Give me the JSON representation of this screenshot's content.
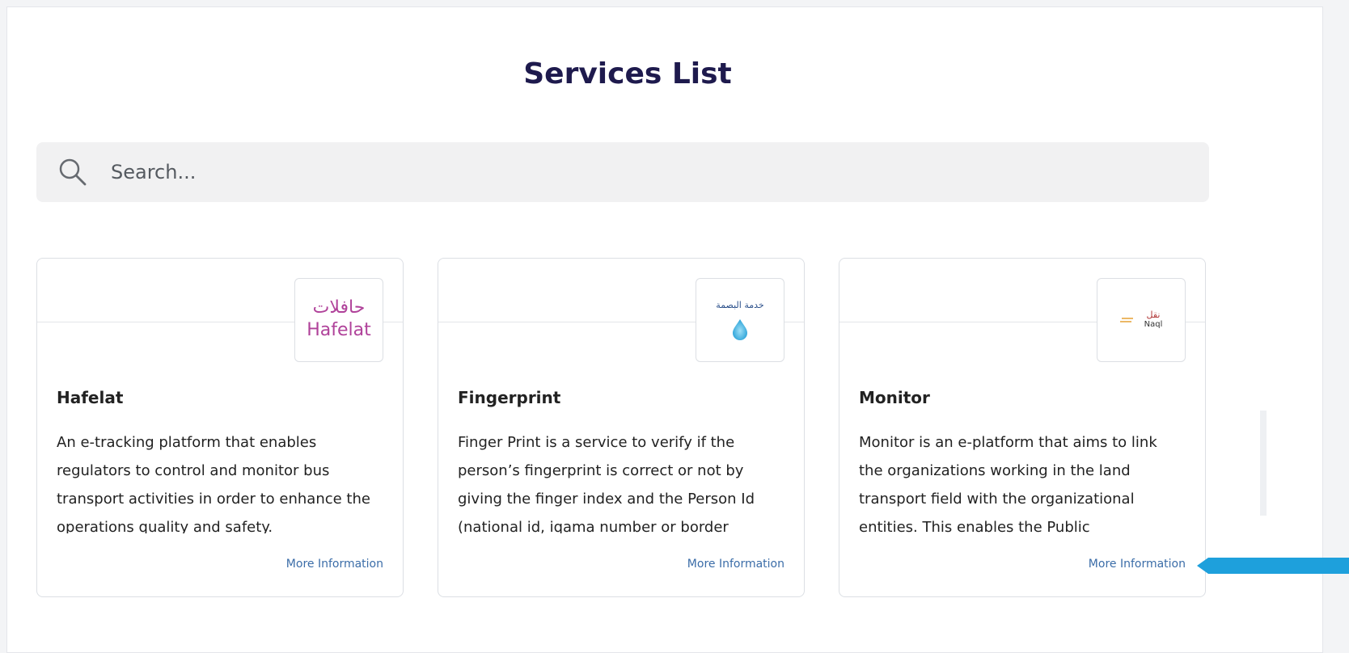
{
  "page": {
    "title": "Services List"
  },
  "search": {
    "placeholder": "Search...",
    "icon": "search-icon"
  },
  "services": [
    {
      "title": "Hafelat",
      "description": "An e-tracking platform that enables regulators to control and monitor bus transport activities in order to enhance the operations quality and safety.",
      "more_label": "More Information",
      "logo": {
        "text_ar": "حافلات",
        "text_en": "Hafelat",
        "color": "#b0429a"
      }
    },
    {
      "title": "Fingerprint",
      "description": "Finger Print is a service to verify if the person’s fingerprint is correct or not by giving the finger index and the Person Id (national id, iqama number or border",
      "more_label": "More Information",
      "logo": {
        "text_ar": "خدمة البصمة",
        "icon": "fingerprint-drop-icon",
        "color": "#2a4f8a"
      }
    },
    {
      "title": "Monitor",
      "description": "Monitor is an e-platform that aims to link the organizations working in the land transport field with the organizational entities. This enables the Public",
      "more_label": "More Information",
      "logo": {
        "text_ar": "نقل",
        "text_en": "Naql",
        "color": "#b13a3a"
      }
    }
  ],
  "colors": {
    "title": "#1e1a4d",
    "link": "#3b6da8",
    "search_bg": "#f1f1f2",
    "pointer": "#1ea0dc"
  }
}
